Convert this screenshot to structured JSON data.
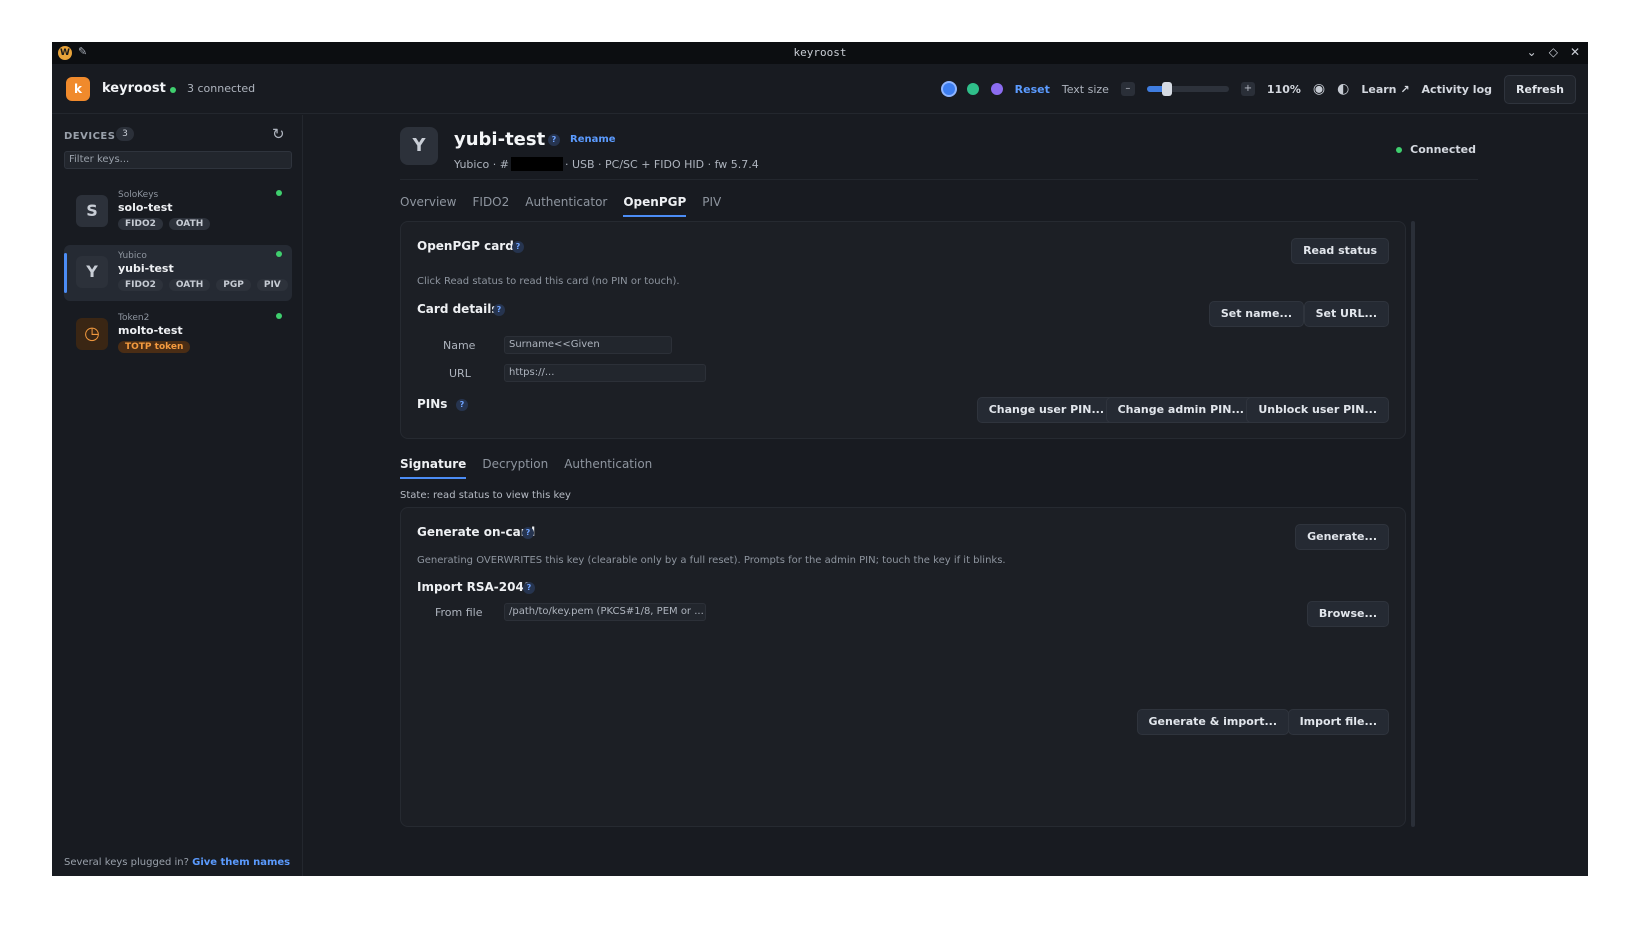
{
  "window": {
    "title": "keyroost"
  },
  "topbar": {
    "logo_letter": "k",
    "app_name": "keyroost",
    "connected_text": "3 connected",
    "theme_colors": [
      "#3d7ef0",
      "#2fbf8a",
      "#8b6cf0"
    ],
    "reset_label": "Reset",
    "text_size_label": "Text size",
    "decrease_label": "–",
    "increase_label": "+",
    "text_size_fraction": 0.25,
    "zoom_value": "110%",
    "learn_label": "Learn ↗",
    "activity_log_label": "Activity log",
    "refresh_label": "Refresh"
  },
  "sidebar": {
    "title": "DEVICES",
    "count": "3",
    "filter_placeholder": "Filter keys...",
    "devices": [
      {
        "avatar": "S",
        "vendor": "SoloKeys",
        "name": "solo-test",
        "tags": [
          "FIDO2",
          "OATH"
        ]
      },
      {
        "avatar": "Y",
        "vendor": "Yubico",
        "name": "yubi-test",
        "tags": [
          "FIDO2",
          "OATH",
          "PGP",
          "PIV"
        ]
      },
      {
        "avatar": "",
        "vendor": "Token2",
        "name": "molto-test",
        "tags": [
          "TOTP token"
        ]
      }
    ],
    "footer_text": "Several keys plugged in?",
    "footer_link": "Give them names"
  },
  "header": {
    "avatar": "Y",
    "name": "yubi-test",
    "help": "?",
    "rename_label": "Rename",
    "meta_prefix": "Yubico · #",
    "meta_suffix": "· USB · PC/SC + FIDO HID · fw 5.7.4",
    "status": "Connected"
  },
  "tabs": [
    "Overview",
    "FIDO2",
    "Authenticator",
    "OpenPGP",
    "PIV"
  ],
  "openpgp": {
    "card_title": "OpenPGP card",
    "read_status_label": "Read status",
    "hint": "Click Read status to read this card (no PIN or touch).",
    "details_title": "Card details",
    "set_name_label": "Set name...",
    "set_url_label": "Set URL...",
    "name_label": "Name",
    "name_placeholder": "Surname<<Given",
    "url_label": "URL",
    "url_placeholder": "https://...",
    "pins_title": "PINs",
    "change_user_pin_label": "Change user PIN...",
    "change_admin_pin_label": "Change admin PIN...",
    "unblock_user_pin_label": "Unblock user PIN..."
  },
  "key_tabs": [
    "Signature",
    "Decryption",
    "Authentication"
  ],
  "key_state": "State: read status to view this key",
  "generate": {
    "title": "Generate on-card",
    "button_label": "Generate...",
    "warning": "Generating OVERWRITES this key (clearable only by a full reset). Prompts for the admin PIN; touch the key if it blinks.",
    "import_title": "Import RSA-2048",
    "from_file_label": "From file",
    "file_placeholder": "/path/to/key.pem (PKCS#1/8, PEM or ...",
    "browse_label": "Browse...",
    "gen_import_label": "Generate & import...",
    "import_file_label": "Import file..."
  }
}
